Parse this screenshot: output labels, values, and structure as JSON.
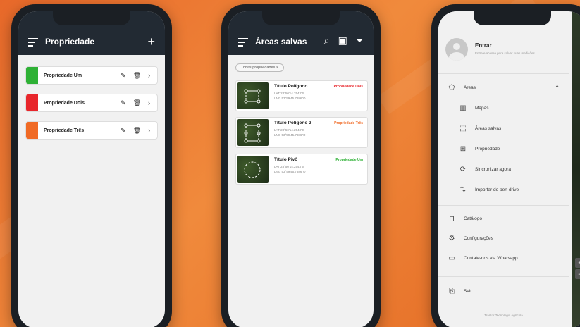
{
  "colors": {
    "red": "#e8262b",
    "green": "#2eb135",
    "orange": "#f06a25"
  },
  "screen1": {
    "title": "Propriedade",
    "add_icon": "+",
    "properties": [
      {
        "label": "Propriedade Um",
        "color": "#2eb135"
      },
      {
        "label": "Propriedade Dois",
        "color": "#e8262b"
      },
      {
        "label": "Propriedade Três",
        "color": "#f06a25"
      }
    ]
  },
  "screen2": {
    "title": "Áreas salvas",
    "filter_chip": "Todas propriedades",
    "areas": [
      {
        "title": "Título Polígono",
        "lat": "LAT 23°50'14.2543\"S",
        "lng": "LNG 53°59'45.7886\"O",
        "tag": "Propriedade Dois",
        "tag_color": "#e8262b"
      },
      {
        "title": "Título Polígono 2",
        "lat": "LAT 23°50'14.2543\"S",
        "lng": "LNG 53°59'45.7886\"O",
        "tag": "Propriedade Três",
        "tag_color": "#f06a25"
      },
      {
        "title": "Título Pivô",
        "lat": "LAT 23°50'14.2543\"S",
        "lng": "LNG 53°59'45.7886\"O",
        "tag": "Propriedade Um",
        "tag_color": "#2eb135"
      }
    ]
  },
  "screen3": {
    "login_title": "Entrar",
    "login_sub": "Entre e acesse para salvar suas medições",
    "menu": {
      "areas": "Áreas",
      "mapas": "Mapas",
      "areas_salvas": "Áreas salvas",
      "propriedade": "Propriedade",
      "sincronizar": "Sincronizar agora",
      "importar": "Importar do pen-drive",
      "catalogo": "Catálogo",
      "configuracoes": "Configurações",
      "contato": "Contate-nos via Whatsapp",
      "sair": "Sair"
    },
    "footer": "Trantor Tecnologia Agrícola",
    "zoom_in": "+",
    "zoom_out": "−"
  }
}
